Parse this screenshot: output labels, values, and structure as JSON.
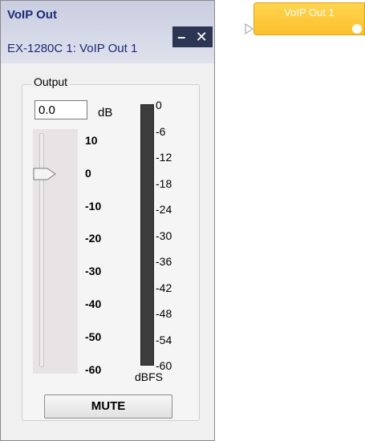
{
  "window": {
    "title": "VoIP Out",
    "subtitle": "EX-1280C 1: VoIP Out 1",
    "minimize_label": "–",
    "close_label": "✕"
  },
  "output": {
    "group_label": "Output",
    "value": "0.0",
    "unit": "dB",
    "fader_scale": [
      "10",
      "0",
      "-10",
      "-20",
      "-30",
      "-40",
      "-50",
      "-60"
    ],
    "fader_level_db": 0
  },
  "meter": {
    "scale": [
      "0",
      "-6",
      "-12",
      "-18",
      "-24",
      "-30",
      "-36",
      "-42",
      "-48",
      "-54",
      "-60"
    ],
    "unit": "dBFS",
    "level_fraction": 0
  },
  "mute": {
    "label": "MUTE"
  },
  "block": {
    "title": "VoIP Out 1"
  },
  "colors": {
    "title_text": "#1e2a78",
    "window_controls_bg": "#2c3552",
    "block_fill": "#fbc02d",
    "meter_bg": "#3d3d3d"
  },
  "icons": {
    "minimize": "minimize-icon",
    "close": "close-icon",
    "fader_thumb": "fader-thumb-icon",
    "input_port": "input-port-icon",
    "status_led": "status-led-icon"
  }
}
